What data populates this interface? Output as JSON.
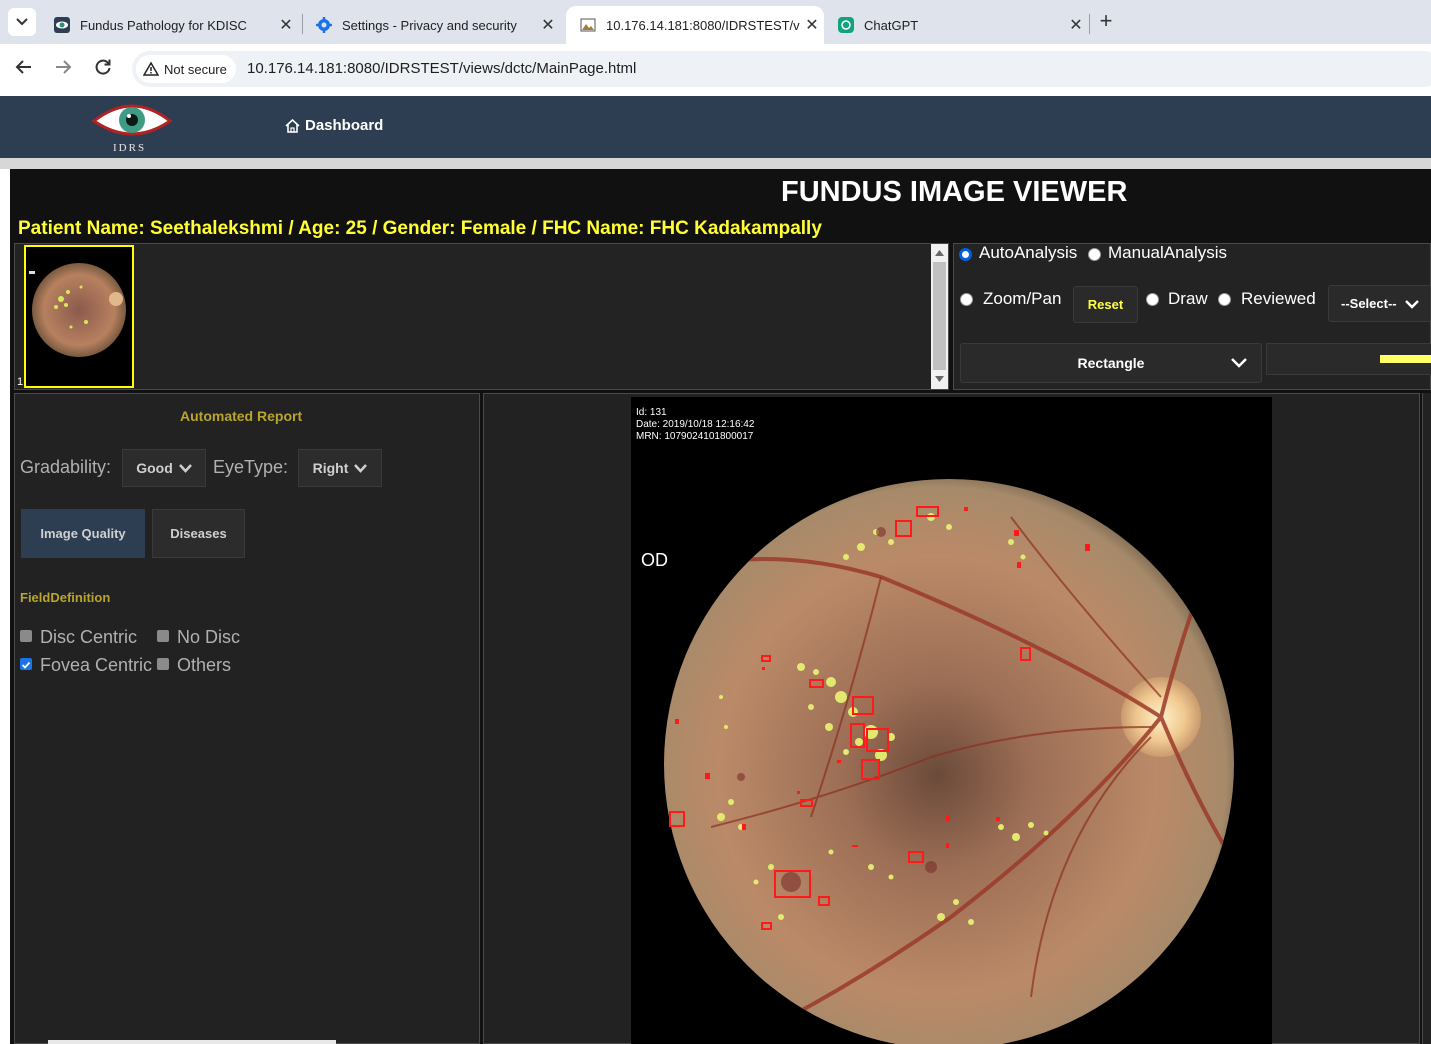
{
  "browser": {
    "tabs": [
      {
        "title": "Fundus Pathology for KDISC",
        "icon": "eye-favicon"
      },
      {
        "title": "Settings - Privacy and security",
        "icon": "gear-icon"
      },
      {
        "title": "10.176.14.181:8080/IDRSTEST/v",
        "icon": "image-favicon"
      },
      {
        "title": "ChatGPT",
        "icon": "chatgpt-icon"
      }
    ],
    "close_glyph": "✕",
    "new_tab_glyph": "+",
    "security_label": "Not secure",
    "url": "10.176.14.181:8080/IDRSTEST/views/dctc/MainPage.html"
  },
  "header": {
    "logo_text": "IDRS",
    "dashboard_label": "Dashboard"
  },
  "viewer": {
    "title": "FUNDUS IMAGE VIEWER",
    "patient_line": "Patient Name: Seethalekshmi / Age: 25 /  Gender: Female /  FHC Name: FHC Kadakampally",
    "thumbnail_index": "1"
  },
  "controls": {
    "auto_analysis": "AutoAnalysis",
    "manual_analysis": "ManualAnalysis",
    "zoom_pan": "Zoom/Pan",
    "reset": "Reset",
    "draw": "Draw",
    "reviewed": "Reviewed",
    "select_placeholder": "--Select--",
    "shape": "Rectangle",
    "analysis_mode": "AutoAnalysis",
    "accent_color": "#ffff66"
  },
  "report": {
    "heading": "Automated Report",
    "gradability_label": "Gradability:",
    "gradability_value": "Good",
    "eyetype_label": "EyeType:",
    "eyetype_value": "Right",
    "tab_image_quality": "Image Quality",
    "tab_diseases": "Diseases",
    "field_definition": "FieldDefinition",
    "options": [
      {
        "label": "Disc Centric",
        "checked": false
      },
      {
        "label": "No Disc",
        "checked": false
      },
      {
        "label": "Fovea Centric",
        "checked": true
      },
      {
        "label": "Others",
        "checked": false
      }
    ]
  },
  "image": {
    "meta_id": "Id: 131",
    "meta_date": "Date: 2019/10/18 12:16:42",
    "meta_mrn": "MRN: 1079024101800017",
    "eye_label": "OD",
    "lesion_box_color": "#ff1a1a"
  }
}
